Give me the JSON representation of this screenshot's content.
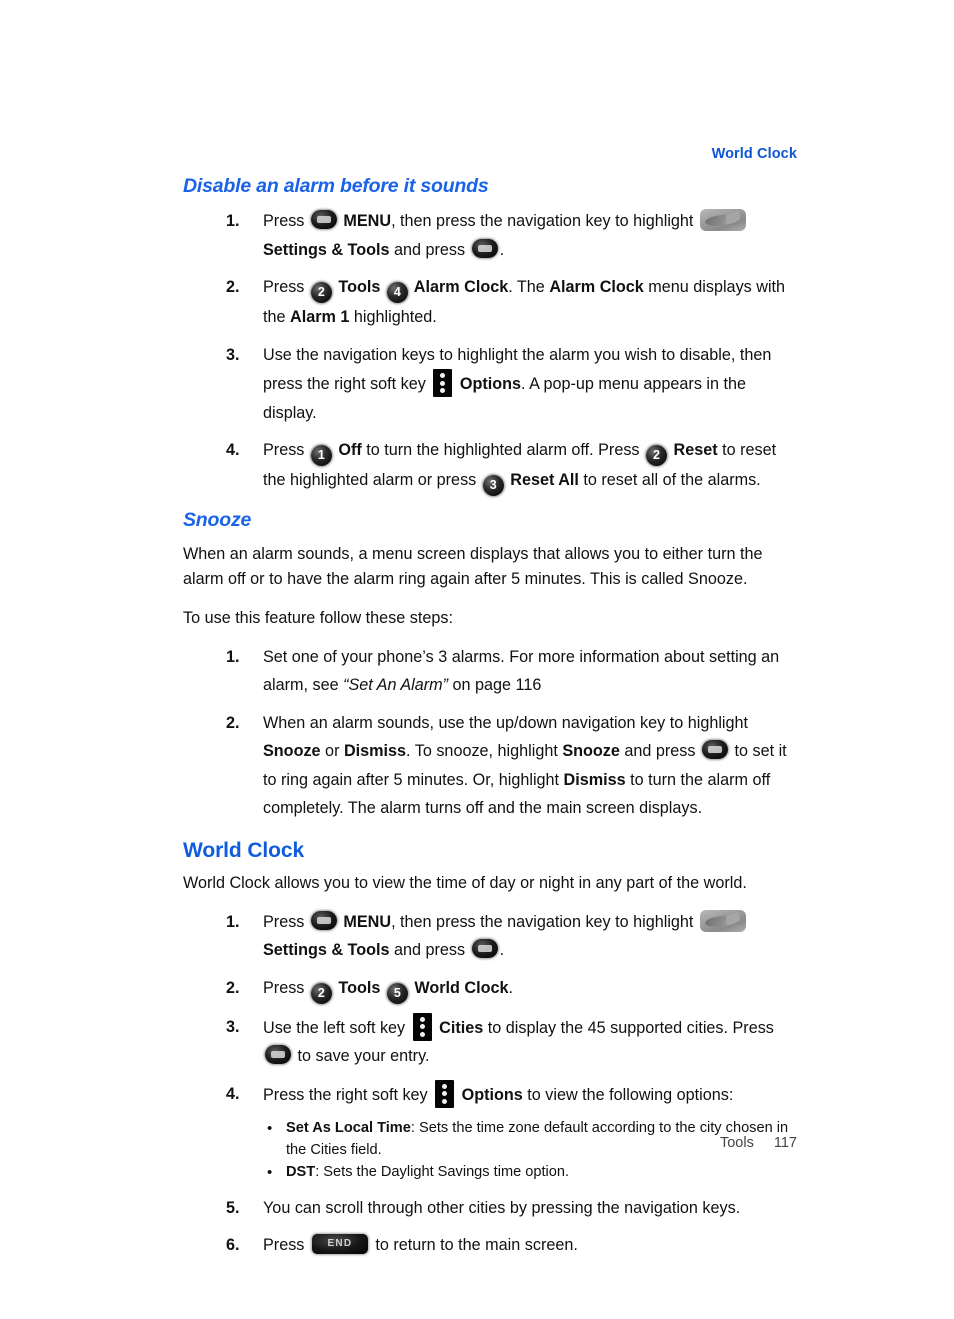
{
  "header": {
    "running_head": "World Clock"
  },
  "footer": {
    "section_label": "Tools",
    "page_number": "117"
  },
  "colors": {
    "heading_blue": "#1a63e8",
    "major_heading_blue": "#0f5cdf",
    "running_head_blue": "#0b55d6",
    "body_text": "#111111",
    "footer_text": "#444444"
  },
  "icons": {
    "ok_key": "ok-key-icon",
    "num_key_1": "number-key-1-icon",
    "num_key_2": "number-key-2-icon",
    "num_key_3": "number-key-3-icon",
    "num_key_4": "number-key-4-icon",
    "num_key_5": "number-key-5-icon",
    "soft_key": "soft-key-icon",
    "settings_tools_thumb": "settings-and-tools-menu-icon",
    "end_key": "end-key-icon",
    "end_key_label": "END"
  },
  "sections": {
    "disable_alarm": {
      "heading": "Disable an alarm before it sounds",
      "steps": [
        {
          "number": "1.",
          "parts": [
            {
              "t": "text",
              "v": "Press "
            },
            {
              "t": "icon",
              "v": "ok"
            },
            {
              "t": "bold",
              "v": " MENU"
            },
            {
              "t": "text",
              "v": ", then press the navigation key to highlight "
            },
            {
              "t": "icon",
              "v": "menu-thumb"
            },
            {
              "t": "break",
              "v": ""
            },
            {
              "t": "bold",
              "v": "Settings & Tools"
            },
            {
              "t": "text",
              "v": " and press "
            },
            {
              "t": "icon",
              "v": "ok"
            },
            {
              "t": "text",
              "v": "."
            }
          ]
        },
        {
          "number": "2.",
          "parts": [
            {
              "t": "text",
              "v": "Press "
            },
            {
              "t": "icon",
              "v": "num2"
            },
            {
              "t": "bold",
              "v": " Tools "
            },
            {
              "t": "icon",
              "v": "num4"
            },
            {
              "t": "bold",
              "v": " Alarm Clock"
            },
            {
              "t": "text",
              "v": ". The "
            },
            {
              "t": "bold",
              "v": "Alarm Clock"
            },
            {
              "t": "text",
              "v": " menu displays with the "
            },
            {
              "t": "bold",
              "v": "Alarm 1"
            },
            {
              "t": "text",
              "v": " highlighted."
            }
          ]
        },
        {
          "number": "3.",
          "parts": [
            {
              "t": "text",
              "v": "Use the navigation keys to highlight the alarm you wish to disable, then press the right soft key "
            },
            {
              "t": "icon",
              "v": "soft"
            },
            {
              "t": "bold",
              "v": " Options"
            },
            {
              "t": "text",
              "v": ". A pop-up menu appears in the display."
            }
          ]
        },
        {
          "number": "4.",
          "parts": [
            {
              "t": "text",
              "v": "Press "
            },
            {
              "t": "icon",
              "v": "num1"
            },
            {
              "t": "bold",
              "v": " Off"
            },
            {
              "t": "text",
              "v": " to turn the highlighted alarm off. Press "
            },
            {
              "t": "icon",
              "v": "num2"
            },
            {
              "t": "bold",
              "v": " Reset"
            },
            {
              "t": "text",
              "v": " to reset the highlighted alarm or press "
            },
            {
              "t": "icon",
              "v": "num3"
            },
            {
              "t": "bold",
              "v": " Reset All"
            },
            {
              "t": "text",
              "v": " to reset all of the alarms."
            }
          ]
        }
      ]
    },
    "snooze": {
      "heading": "Snooze",
      "paragraph_1": "When an alarm sounds, a menu screen displays that allows you to either turn the alarm off or to have the alarm ring again after 5 minutes. This is called Snooze.",
      "paragraph_2": "To use this feature follow these steps:",
      "steps": [
        {
          "number": "1.",
          "parts": [
            {
              "t": "text",
              "v": "Set one of your phone’s 3 alarms. For more information about setting an alarm, see "
            },
            {
              "t": "italic",
              "v": "“Set An Alarm”"
            },
            {
              "t": "text",
              "v": " on page 116"
            }
          ]
        },
        {
          "number": "2.",
          "parts": [
            {
              "t": "text",
              "v": "When an alarm sounds, use the up/down navigation key to highlight "
            },
            {
              "t": "bold",
              "v": "Snooze"
            },
            {
              "t": "text",
              "v": " or "
            },
            {
              "t": "bold",
              "v": "Dismiss"
            },
            {
              "t": "text",
              "v": ". To snooze, highlight "
            },
            {
              "t": "bold",
              "v": "Snooze"
            },
            {
              "t": "text",
              "v": " and press "
            },
            {
              "t": "icon",
              "v": "ok"
            },
            {
              "t": "text",
              "v": " to set it to ring again after 5 minutes. Or, highlight "
            },
            {
              "t": "bold",
              "v": "Dismiss"
            },
            {
              "t": "text",
              "v": " to turn the alarm off completely. The alarm turns off and the main screen displays."
            }
          ]
        }
      ]
    },
    "world_clock": {
      "heading": "World Clock",
      "paragraph_1": "World Clock allows you to view the time of day or night in any part of the world.",
      "steps": [
        {
          "number": "1.",
          "parts": [
            {
              "t": "text",
              "v": "Press "
            },
            {
              "t": "icon",
              "v": "ok"
            },
            {
              "t": "bold",
              "v": " MENU"
            },
            {
              "t": "text",
              "v": ", then press the navigation key to highlight "
            },
            {
              "t": "icon",
              "v": "menu-thumb"
            },
            {
              "t": "break",
              "v": ""
            },
            {
              "t": "bold",
              "v": "Settings & Tools"
            },
            {
              "t": "text",
              "v": " and press "
            },
            {
              "t": "icon",
              "v": "ok"
            },
            {
              "t": "text",
              "v": "."
            }
          ]
        },
        {
          "number": "2.",
          "parts": [
            {
              "t": "text",
              "v": "Press "
            },
            {
              "t": "icon",
              "v": "num2"
            },
            {
              "t": "bold",
              "v": " Tools "
            },
            {
              "t": "icon",
              "v": "num5"
            },
            {
              "t": "bold",
              "v": " World Clock"
            },
            {
              "t": "text",
              "v": "."
            }
          ]
        },
        {
          "number": "3.",
          "parts": [
            {
              "t": "text",
              "v": "Use the left soft key "
            },
            {
              "t": "icon",
              "v": "soft"
            },
            {
              "t": "bold",
              "v": " Cities"
            },
            {
              "t": "text",
              "v": " to display the 45 supported cities. Press "
            },
            {
              "t": "icon",
              "v": "ok"
            },
            {
              "t": "text",
              "v": " to save your entry."
            }
          ]
        },
        {
          "number": "4.",
          "parts": [
            {
              "t": "text",
              "v": "Press the right soft key "
            },
            {
              "t": "icon",
              "v": "soft"
            },
            {
              "t": "bold",
              "v": " Options"
            },
            {
              "t": "text",
              "v": " to view the following options:"
            }
          ]
        }
      ],
      "bullets": [
        {
          "parts": [
            {
              "t": "bold",
              "v": "Set As Local Time"
            },
            {
              "t": "text",
              "v": ": Sets the time zone default according to the city chosen in the Cities field."
            }
          ]
        },
        {
          "parts": [
            {
              "t": "bold",
              "v": "DST"
            },
            {
              "t": "text",
              "v": ": Sets the Daylight Savings time option."
            }
          ]
        }
      ],
      "steps_tail": [
        {
          "number": "5.",
          "parts": [
            {
              "t": "text",
              "v": "You can scroll through other cities by pressing the navigation keys."
            }
          ]
        },
        {
          "number": "6.",
          "parts": [
            {
              "t": "text",
              "v": "Press "
            },
            {
              "t": "icon",
              "v": "end"
            },
            {
              "t": "text",
              "v": " to return to the main screen."
            }
          ]
        }
      ]
    }
  }
}
